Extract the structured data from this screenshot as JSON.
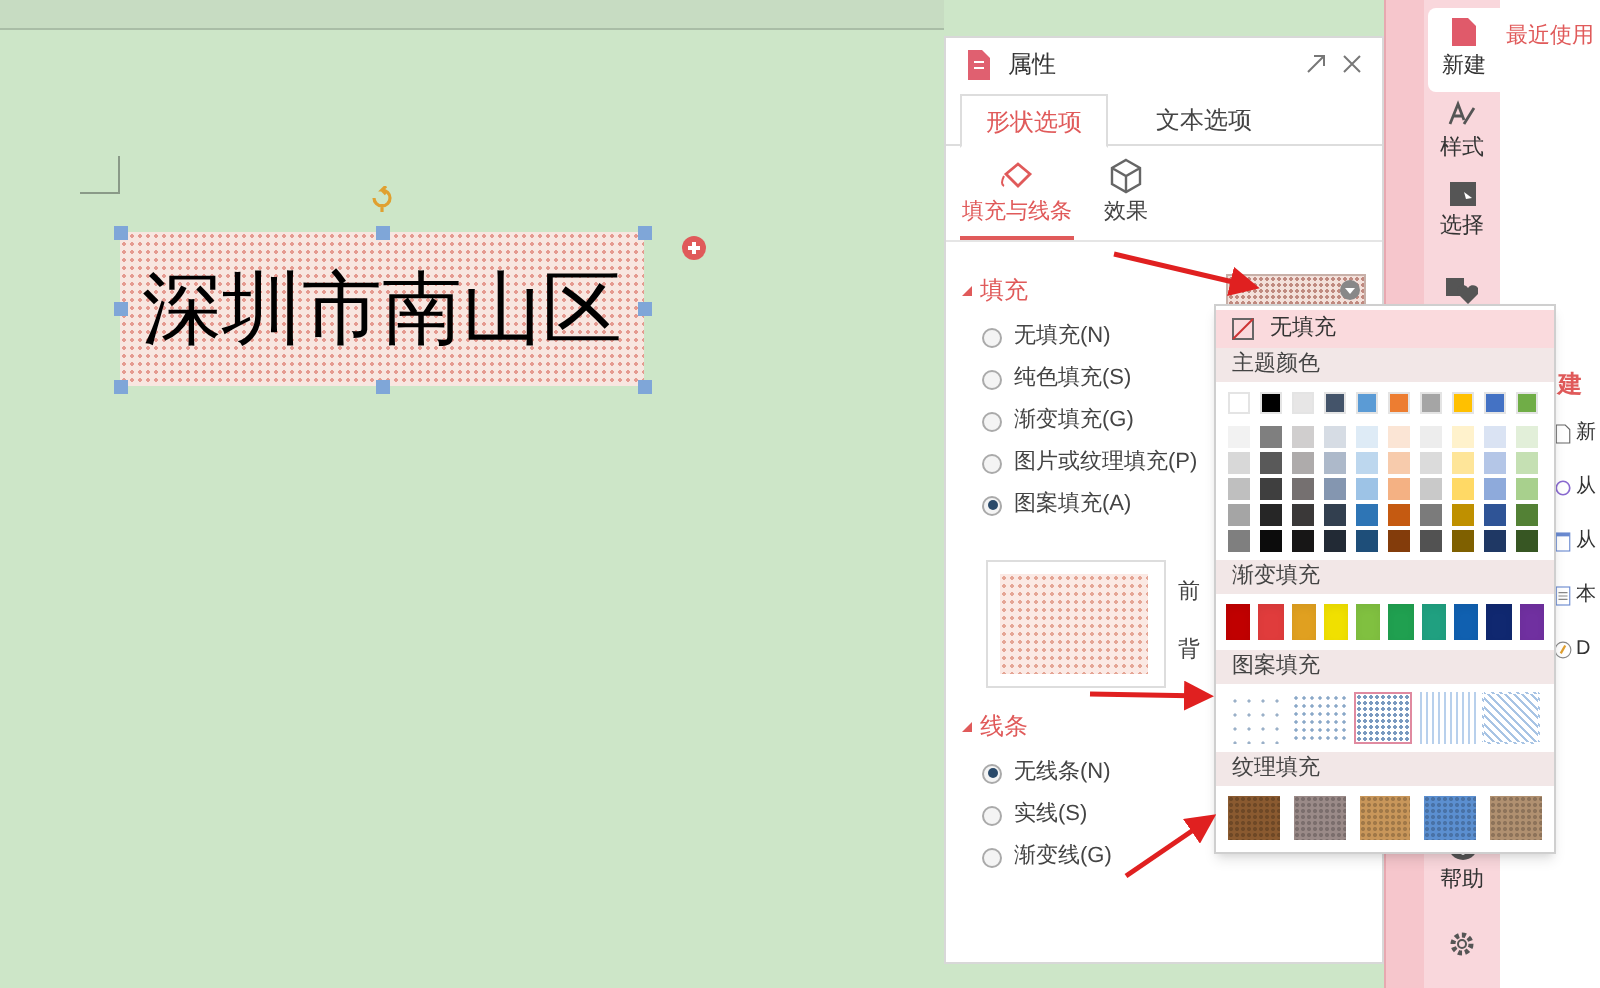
{
  "document": {
    "shape_text": "深圳市南山区"
  },
  "panel": {
    "title": "属性",
    "tabs": [
      {
        "label": "形状选项",
        "selected": true
      },
      {
        "label": "文本选项",
        "selected": false
      }
    ],
    "subtabs": [
      {
        "label": "填充与线条",
        "selected": true
      },
      {
        "label": "效果",
        "selected": false
      }
    ],
    "fill": {
      "heading": "填充",
      "options": [
        {
          "label": "无填充(N)",
          "selected": false
        },
        {
          "label": "纯色填充(S)",
          "selected": false
        },
        {
          "label": "渐变填充(G)",
          "selected": false
        },
        {
          "label": "图片或纹理填充(P)",
          "selected": false
        },
        {
          "label": "图案填充(A)",
          "selected": true
        }
      ],
      "foreground_label": "前",
      "background_label": "背"
    },
    "line": {
      "heading": "线条",
      "options": [
        {
          "label": "无线条(N)",
          "selected": true
        },
        {
          "label": "实线(S)",
          "selected": false
        },
        {
          "label": "渐变线(G)",
          "selected": false
        }
      ]
    }
  },
  "popup": {
    "no_fill": "无填充",
    "theme_heading": "主题颜色",
    "theme_colors": [
      {
        "color": "#ffffff"
      },
      {
        "color": "#000000"
      },
      {
        "color": "#e7e6e6"
      },
      {
        "color": "#44546a"
      },
      {
        "color": "#5b9bd5"
      },
      {
        "color": "#ed7d31"
      },
      {
        "color": "#a5a5a5"
      },
      {
        "color": "#ffc000"
      },
      {
        "color": "#4472c4"
      },
      {
        "color": "#70ad47"
      }
    ],
    "shades": [
      [
        {
          "color": "#f2f2f2"
        },
        {
          "color": "#7f7f7f"
        },
        {
          "color": "#d0cece"
        },
        {
          "color": "#d6dce4"
        },
        {
          "color": "#deebf6"
        },
        {
          "color": "#fbe5d5"
        },
        {
          "color": "#ededed"
        },
        {
          "color": "#fff2cc"
        },
        {
          "color": "#dae3f3"
        },
        {
          "color": "#e2efd9"
        }
      ],
      [
        {
          "color": "#d8d8d8"
        },
        {
          "color": "#595959"
        },
        {
          "color": "#aeabab"
        },
        {
          "color": "#adb9ca"
        },
        {
          "color": "#bdd7ee"
        },
        {
          "color": "#f7cbac"
        },
        {
          "color": "#dbdbdb"
        },
        {
          "color": "#fee599"
        },
        {
          "color": "#b4c6e7"
        },
        {
          "color": "#c5e0b3"
        }
      ],
      [
        {
          "color": "#bfbfbf"
        },
        {
          "color": "#3f3f3f"
        },
        {
          "color": "#757070"
        },
        {
          "color": "#8496b0"
        },
        {
          "color": "#9dc3e6"
        },
        {
          "color": "#f4b183"
        },
        {
          "color": "#c9c9c9"
        },
        {
          "color": "#ffd965"
        },
        {
          "color": "#8eaadb"
        },
        {
          "color": "#a8d08d"
        }
      ],
      [
        {
          "color": "#a5a5a5"
        },
        {
          "color": "#262626"
        },
        {
          "color": "#3a3838"
        },
        {
          "color": "#323f4f"
        },
        {
          "color": "#2e75b5"
        },
        {
          "color": "#c55a11"
        },
        {
          "color": "#7b7b7b"
        },
        {
          "color": "#bf9000"
        },
        {
          "color": "#2f5496"
        },
        {
          "color": "#538135"
        }
      ],
      [
        {
          "color": "#7f7f7f"
        },
        {
          "color": "#0c0c0c"
        },
        {
          "color": "#171616"
        },
        {
          "color": "#222a35"
        },
        {
          "color": "#1e4e79"
        },
        {
          "color": "#833c0b"
        },
        {
          "color": "#525252"
        },
        {
          "color": "#7f6000"
        },
        {
          "color": "#1f3864"
        },
        {
          "color": "#375623"
        }
      ]
    ],
    "gradient_heading": "渐变填充",
    "gradients": [
      {
        "color": "#c00000"
      },
      {
        "color": "#e03c3c"
      },
      {
        "color": "#e0a020"
      },
      {
        "color": "#f0e000"
      },
      {
        "color": "#80c040"
      },
      {
        "color": "#20a050"
      },
      {
        "color": "#20a080"
      },
      {
        "color": "#1060b0"
      },
      {
        "color": "#102870"
      },
      {
        "color": "#7030a0"
      }
    ],
    "pattern_heading": "图案填充",
    "patterns": [
      {
        "selected": false
      },
      {
        "selected": false
      },
      {
        "selected": true
      },
      {
        "selected": false
      },
      {
        "selected": false
      }
    ],
    "texture_heading": "纹理填充",
    "textures": [
      {
        "color": "#8a5a30"
      },
      {
        "color": "#9a8a88"
      },
      {
        "color": "#c8965a"
      },
      {
        "color": "#5b8fd0"
      },
      {
        "color": "#b09070"
      }
    ]
  },
  "sidebar": {
    "tabs": [
      {
        "label": "新建",
        "kind": "page",
        "selected": true
      },
      {
        "label": "样式",
        "kind": "style",
        "selected": false
      },
      {
        "label": "选择",
        "kind": "select",
        "selected": false
      },
      {
        "kind": "shapes",
        "selected": false
      },
      {
        "label": "帮助",
        "kind": "help",
        "selected": false
      },
      {
        "kind": "settings",
        "selected": false
      }
    ],
    "recent_heading": "最近使用",
    "new_heading": "建",
    "items": [
      {
        "label": "新",
        "kind": "doc"
      },
      {
        "label": "从",
        "kind": "ring"
      },
      {
        "label": "从",
        "kind": "sheet"
      },
      {
        "label": "本",
        "kind": "list"
      },
      {
        "label": "D",
        "kind": "disc"
      }
    ]
  }
}
